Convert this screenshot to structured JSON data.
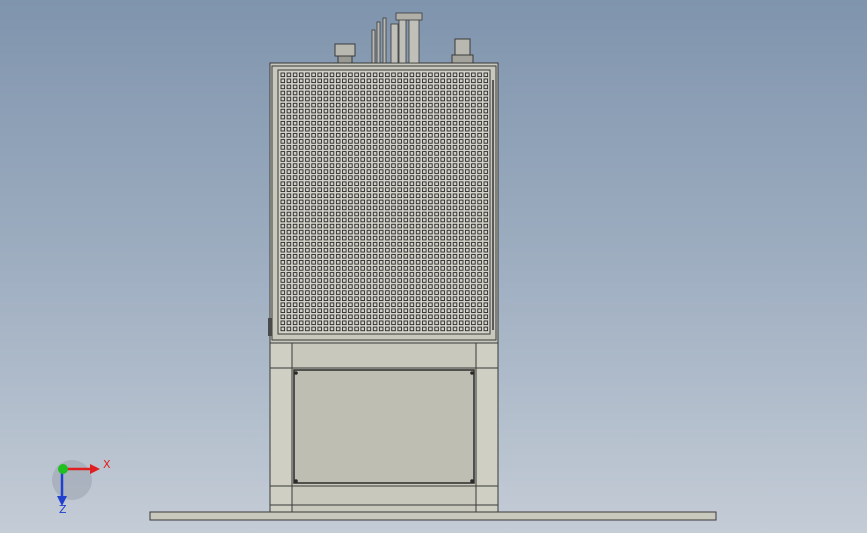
{
  "viewport": {
    "background_top": "#7f94ad",
    "background_bottom": "#c4ccd6"
  },
  "model": {
    "body_color": "#c8c8bc",
    "edge_color": "#3a3a3a",
    "hole_color": "#2a2a2a"
  },
  "triad": {
    "x_label": "X",
    "z_label": "Z",
    "x_color": "#e02020",
    "y_color": "#20c020",
    "z_color": "#2040d0"
  }
}
